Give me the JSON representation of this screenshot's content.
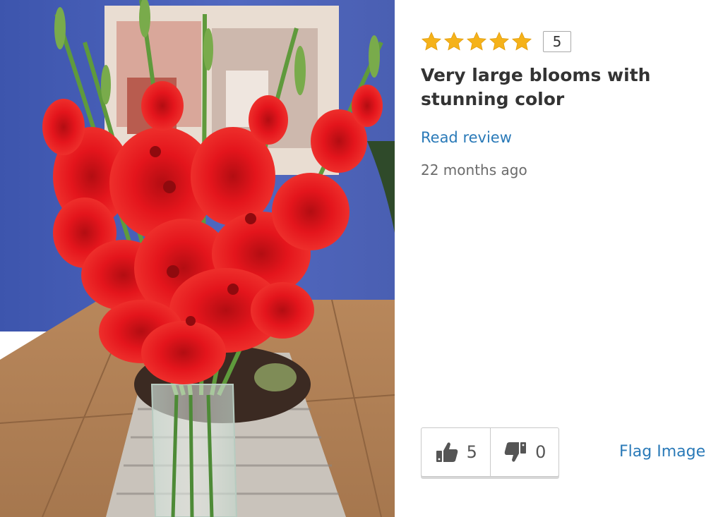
{
  "photo": {
    "alt_icon": "red-gladiolus-bouquet"
  },
  "review": {
    "rating": 5,
    "rating_badge": "5",
    "title": "Very large blooms with stunning color",
    "read_review_label": "Read review",
    "age": "22 months ago"
  },
  "votes": {
    "up_count": "5",
    "down_count": "0"
  },
  "flag_label": "Flag Image",
  "colors": {
    "star": "#f5b21a",
    "link": "#2a7ab8",
    "title": "#333333",
    "wall": "#4d63b8",
    "bloom": "#e4151c"
  }
}
